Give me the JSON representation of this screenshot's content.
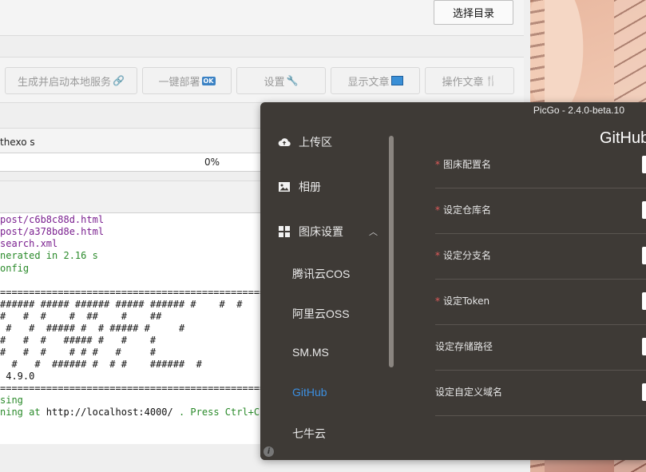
{
  "top_panel": {
    "choose_dir_label": "选择目录"
  },
  "toolbar": {
    "start_label": "生成并启动本地服务",
    "deploy_label": "一键部署",
    "settings_label": "设置",
    "show_article_label": "显示文章",
    "article_ops_label": "操作文章",
    "ok_badge": "OK"
  },
  "command": {
    "text": "thexo s"
  },
  "progress": {
    "value_text": "0%"
  },
  "console": {
    "line1": "post/c6b8c88d.html",
    "line2": "post/a378bd8e.html",
    "line3": "search.xml",
    "line4": "nerated in 2.16 s",
    "line5": "onfig",
    "rule1": "==============================================",
    "art1": "###### ##### ###### ##### ###### #    #  #",
    "art2": "#   #  #    #  ##    #    ##",
    "art3": " #   #  ##### #  # ##### #     #",
    "art4": "#   #  #   ##### #   #    #",
    "art5": "#   #  #    # # #   #     #",
    "art6": "  #   #  ###### #  # #    ######  #",
    "version": " 4.9.0",
    "rule2": "==============================================",
    "line6": "sing",
    "line7_prefix": "ning at ",
    "line7_url": "http://localhost:4000/",
    "line7_suffix": " . Press Ctrl+C to stop."
  },
  "picgo": {
    "title": "PicGo - 2.4.0-beta.10",
    "nav": {
      "upload": "上传区",
      "album": "相册",
      "bed_settings": "图床设置",
      "sub": [
        "腾讯云COS",
        "阿里云OSS",
        "SM.MS",
        "GitHub",
        "七牛云"
      ]
    },
    "heading": "GitHub",
    "fields": [
      {
        "label": "图床配置名",
        "required": "*"
      },
      {
        "label": "设定仓库名",
        "required": "*"
      },
      {
        "label": "设定分支名",
        "required": "*"
      },
      {
        "label": "设定Token",
        "required": "*"
      },
      {
        "label": "设定存储路径",
        "required": ""
      },
      {
        "label": "设定自定义域名",
        "required": ""
      }
    ],
    "info_icon": "i"
  },
  "colors": {
    "accent": "#3c8fe0",
    "picgo_bg": "#3e3a36",
    "required": "#e05a5a"
  }
}
